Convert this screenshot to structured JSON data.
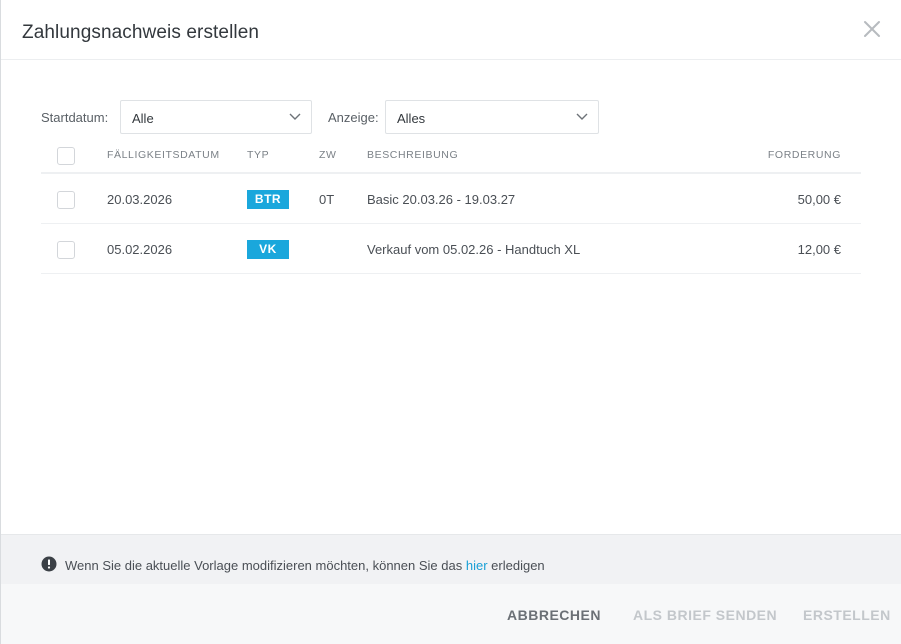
{
  "dialog": {
    "title": "Zahlungsnachweis erstellen"
  },
  "filters": {
    "start_label": "Startdatum:",
    "start_value": "Alle",
    "display_label": "Anzeige:",
    "display_value": "Alles"
  },
  "table": {
    "headers": {
      "due_date": "FÄLLIGKEITSDATUM",
      "type": "TYP",
      "zw": "ZW",
      "description": "BESCHREIBUNG",
      "amount": "FORDERUNG"
    },
    "rows": [
      {
        "due_date": "20.03.2026",
        "type": "BTR",
        "zw": "0T",
        "description": "Basic 20.03.26 - 19.03.27",
        "amount": "50,00 €"
      },
      {
        "due_date": "05.02.2026",
        "type": "VK",
        "zw": "",
        "description": "Verkauf vom 05.02.26 - Handtuch XL",
        "amount": "12,00 €"
      }
    ]
  },
  "notice": {
    "text_before": "Wenn Sie die aktuelle Vorlage modifizieren möchten, können Sie das",
    "link": "hier",
    "text_after": "erledigen"
  },
  "footer": {
    "cancel": "ABBRECHEN",
    "send_letter": "ALS BRIEF SENDEN",
    "create": "ERSTELLEN"
  },
  "colors": {
    "badge": "#1aa7dc",
    "link": "#1aa0d6",
    "disabled_button": "#c3c7cb"
  }
}
